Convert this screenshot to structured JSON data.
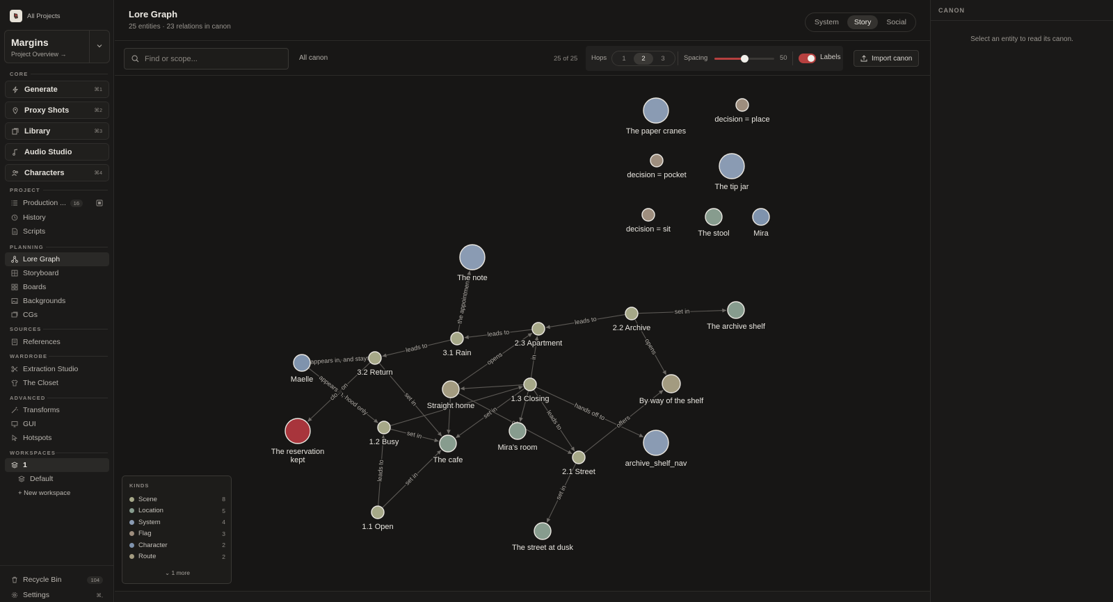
{
  "sidebar": {
    "all_projects": "All Projects",
    "project": {
      "name": "Margins",
      "subtitle": "Project Overview →"
    },
    "core_label": "CORE",
    "core": [
      {
        "label": "Generate",
        "icon": "bolt-icon",
        "kbd": "⌘1"
      },
      {
        "label": "Proxy Shots",
        "icon": "pin-icon",
        "kbd": "⌘2"
      },
      {
        "label": "Library",
        "icon": "library-icon",
        "kbd": "⌘3"
      },
      {
        "label": "Audio Studio",
        "icon": "music-icon",
        "kbd": ""
      },
      {
        "label": "Characters",
        "icon": "users-icon",
        "kbd": "⌘4"
      }
    ],
    "project_label": "PROJECT",
    "project_items": [
      {
        "label": "Production ...",
        "icon": "list-icon",
        "badge": "16"
      },
      {
        "label": "History",
        "icon": "history-icon"
      },
      {
        "label": "Scripts",
        "icon": "script-icon"
      }
    ],
    "planning_label": "PLANNING",
    "planning_items": [
      {
        "label": "Lore Graph",
        "icon": "graph-icon",
        "active": true
      },
      {
        "label": "Storyboard",
        "icon": "storyboard-icon"
      },
      {
        "label": "Boards",
        "icon": "boards-icon"
      },
      {
        "label": "Backgrounds",
        "icon": "image-icon"
      },
      {
        "label": "CGs",
        "icon": "cg-icon"
      }
    ],
    "sources_label": "SOURCES",
    "sources_items": [
      {
        "label": "References",
        "icon": "document-icon"
      }
    ],
    "wardrobe_label": "WARDROBE",
    "wardrobe_items": [
      {
        "label": "Extraction Studio",
        "icon": "scissors-icon"
      },
      {
        "label": "The Closet",
        "icon": "shirt-icon"
      }
    ],
    "advanced_label": "ADVANCED",
    "advanced_items": [
      {
        "label": "Transforms",
        "icon": "wand-icon"
      },
      {
        "label": "GUI",
        "icon": "monitor-icon"
      },
      {
        "label": "Hotspots",
        "icon": "hotspot-icon"
      }
    ],
    "workspaces_label": "WORKSPACES",
    "workspaces": [
      {
        "label": "1",
        "active": true
      },
      {
        "label": "Default"
      }
    ],
    "new_workspace": "+ New workspace",
    "recycle_bin": {
      "label": "Recycle Bin",
      "badge": "104"
    },
    "settings": {
      "label": "Settings",
      "kbd": "⌘,"
    }
  },
  "header": {
    "title": "Lore Graph",
    "subtitle": "25 entities · 23 relations in canon",
    "views": [
      "System",
      "Story",
      "Social"
    ],
    "active_view": "Story"
  },
  "toolbar": {
    "search_placeholder": "Find or scope...",
    "scope": "All canon",
    "count": "25 of 25",
    "hops_label": "Hops",
    "hops": [
      "1",
      "2",
      "3"
    ],
    "hops_selected": "2",
    "spacing_label": "Spacing",
    "spacing_value": "50",
    "spacing_fraction": 0.5,
    "labels_label": "Labels",
    "labels_on": true,
    "import_label": "Import canon"
  },
  "colors": {
    "scene": "#a6a888",
    "location": "#879c8e",
    "system": "#8a9bb3",
    "flag": "#9e8e7e",
    "character": "#7f93ad",
    "route": "#a39b80",
    "accent": "#b6403f",
    "emphasis_node": "#a8353c"
  },
  "graph": {
    "nodes": [
      {
        "id": "paper_cranes",
        "label": "The paper cranes",
        "kind": "system"
      },
      {
        "id": "decision_place",
        "label": "decision = place",
        "kind": "flag"
      },
      {
        "id": "decision_pocket",
        "label": "decision = pocket",
        "kind": "flag"
      },
      {
        "id": "tip_jar",
        "label": "The tip jar",
        "kind": "system"
      },
      {
        "id": "decision_sit",
        "label": "decision = sit",
        "kind": "flag"
      },
      {
        "id": "stool",
        "label": "The stool",
        "kind": "location"
      },
      {
        "id": "mira",
        "label": "Mira",
        "kind": "character"
      },
      {
        "id": "note",
        "label": "The note",
        "kind": "system"
      },
      {
        "id": "archive",
        "label": "2.2 Archive",
        "kind": "scene"
      },
      {
        "id": "archive_shelf",
        "label": "The archive shelf",
        "kind": "location"
      },
      {
        "id": "apartment",
        "label": "2.3 Apartment",
        "kind": "scene"
      },
      {
        "id": "rain",
        "label": "3.1 Rain",
        "kind": "scene"
      },
      {
        "id": "return",
        "label": "3.2 Return",
        "kind": "scene"
      },
      {
        "id": "maelle",
        "label": "Maelle",
        "kind": "character"
      },
      {
        "id": "straight_home",
        "label": "Straight home",
        "kind": "route"
      },
      {
        "id": "closing",
        "label": "1.3 Closing",
        "kind": "scene"
      },
      {
        "id": "by_way_shelf",
        "label": "By way of the shelf",
        "kind": "route"
      },
      {
        "id": "reservation",
        "label": "The reservation kept",
        "kind": "emphasis"
      },
      {
        "id": "busy",
        "label": "1.2 Busy",
        "kind": "scene"
      },
      {
        "id": "cafe",
        "label": "The cafe",
        "kind": "location"
      },
      {
        "id": "miras_room",
        "label": "Mira's room",
        "kind": "location"
      },
      {
        "id": "street",
        "label": "2.1 Street",
        "kind": "scene"
      },
      {
        "id": "archive_nav",
        "label": "archive_shelf_nav",
        "kind": "system"
      },
      {
        "id": "open",
        "label": "1.1 Open",
        "kind": "scene"
      },
      {
        "id": "street_dusk",
        "label": "The street at dusk",
        "kind": "location"
      }
    ],
    "edges": [
      {
        "from": "rain",
        "to": "note",
        "label": "the appointment"
      },
      {
        "from": "archive",
        "to": "archive_shelf",
        "label": "set in"
      },
      {
        "from": "archive",
        "to": "apartment",
        "label": "leads to"
      },
      {
        "from": "apartment",
        "to": "rain",
        "label": "leads to"
      },
      {
        "from": "rain",
        "to": "return",
        "label": "leads to"
      },
      {
        "from": "straight_home",
        "to": "apartment",
        "label": "opens"
      },
      {
        "from": "archive",
        "to": "by_way_shelf",
        "label": "opens"
      },
      {
        "from": "closing",
        "to": "apartment",
        "label": "in"
      },
      {
        "from": "return",
        "to": "maelle",
        "label": "appears in, and stays"
      },
      {
        "from": "maelle",
        "to": "busy",
        "label": "appears in, hood only"
      },
      {
        "from": "return",
        "to": "reservation",
        "label": "clo... on"
      },
      {
        "from": "return",
        "to": "cafe",
        "label": "set in"
      },
      {
        "from": "busy",
        "to": "cafe",
        "label": "set in"
      },
      {
        "from": "busy",
        "to": "closing",
        "label": ""
      },
      {
        "from": "closing",
        "to": "cafe",
        "label": "set in"
      },
      {
        "from": "closing",
        "to": "miras_room",
        "label": ""
      },
      {
        "from": "straight_home",
        "to": "cafe",
        "label": ""
      },
      {
        "from": "closing",
        "to": "straight_home",
        "label": ""
      },
      {
        "from": "straight_home",
        "to": "street",
        "label": "off"
      },
      {
        "from": "closing",
        "to": "street",
        "label": "leads to"
      },
      {
        "from": "closing",
        "to": "archive_nav",
        "label": "hands off to"
      },
      {
        "from": "street",
        "to": "by_way_shelf",
        "label": "offers"
      },
      {
        "from": "open",
        "to": "busy",
        "label": "leads to"
      },
      {
        "from": "open",
        "to": "cafe",
        "label": "set in"
      },
      {
        "from": "street",
        "to": "street_dusk",
        "label": "set in"
      }
    ]
  },
  "legend": {
    "title": "KINDS",
    "items": [
      {
        "label": "Scene",
        "count": "8",
        "kind": "scene"
      },
      {
        "label": "Location",
        "count": "5",
        "kind": "location"
      },
      {
        "label": "System",
        "count": "4",
        "kind": "system"
      },
      {
        "label": "Flag",
        "count": "3",
        "kind": "flag"
      },
      {
        "label": "Character",
        "count": "2",
        "kind": "character"
      },
      {
        "label": "Route",
        "count": "2",
        "kind": "route"
      }
    ],
    "more": "1 more"
  },
  "canon": {
    "title": "CANON",
    "empty": "Select an entity to read its canon."
  }
}
